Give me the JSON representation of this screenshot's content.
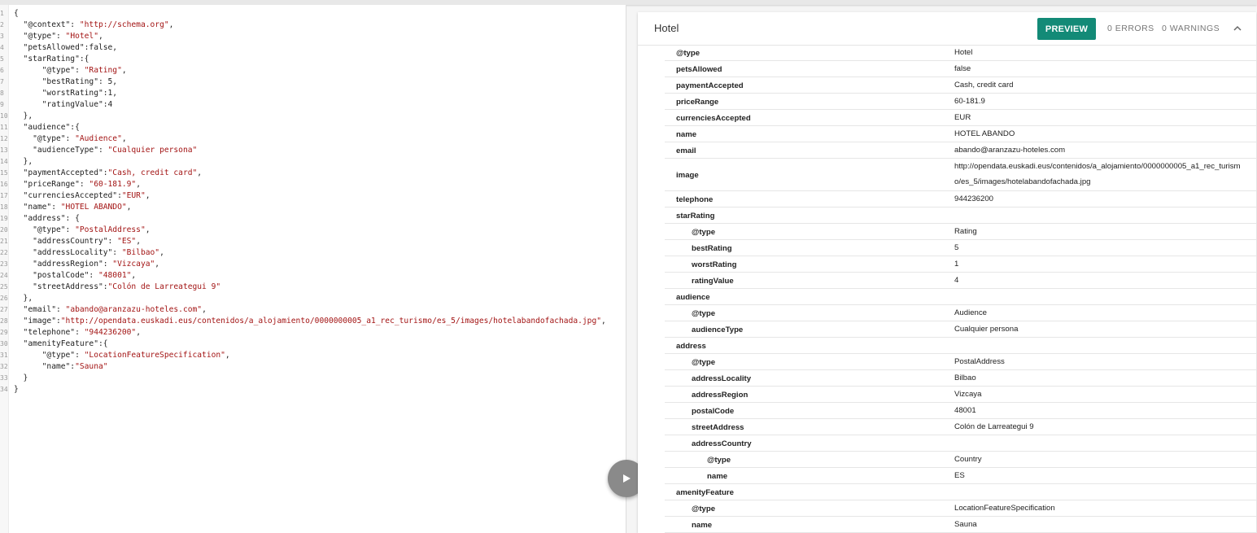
{
  "editor": {
    "lines": [
      "{",
      "  \"@context\": \"http://schema.org\",",
      "  \"@type\": \"Hotel\",",
      "  \"petsAllowed\":false,",
      "  \"starRating\":{",
      "      \"@type\": \"Rating\",",
      "      \"bestRating\": 5,",
      "      \"worstRating\":1,",
      "      \"ratingValue\":4",
      "  },",
      "  \"audience\":{",
      "    \"@type\": \"Audience\",",
      "    \"audienceType\": \"Cualquier persona\"",
      "  },",
      "  \"paymentAccepted\":\"Cash, credit card\",",
      "  \"priceRange\": \"60-181.9\",",
      "  \"currenciesAccepted\":\"EUR\",",
      "  \"name\": \"HOTEL ABANDO\",",
      "  \"address\": {",
      "    \"@type\": \"PostalAddress\",",
      "    \"addressCountry\": \"ES\",",
      "    \"addressLocality\": \"Bilbao\",",
      "    \"addressRegion\": \"Vizcaya\",",
      "    \"postalCode\": \"48001\",",
      "    \"streetAddress\":\"Colón de Larreategui 9\"",
      "  },",
      "  \"email\": \"abando@aranzazu-hoteles.com\",",
      "  \"image\":\"http://opendata.euskadi.eus/contenidos/a_alojamiento/0000000005_a1_rec_turismo/es_5/images/hotelabandofachada.jpg\",",
      "  \"telephone\": \"944236200\",",
      "  \"amenityFeature\":{",
      "      \"@type\": \"LocationFeatureSpecification\",",
      "      \"name\":\"Sauna\"",
      "  }",
      "}"
    ]
  },
  "panel": {
    "title": "Hotel",
    "preview_label": "PREVIEW",
    "errors_label": "0 ERRORS",
    "warnings_label": "0 WARNINGS",
    "rows": [
      {
        "prop": "@type",
        "value": "Hotel",
        "depth": 0
      },
      {
        "prop": "petsAllowed",
        "value": "false",
        "depth": 0
      },
      {
        "prop": "paymentAccepted",
        "value": "Cash, credit card",
        "depth": 0
      },
      {
        "prop": "priceRange",
        "value": "60-181.9",
        "depth": 0
      },
      {
        "prop": "currenciesAccepted",
        "value": "EUR",
        "depth": 0
      },
      {
        "prop": "name",
        "value": "HOTEL ABANDO",
        "depth": 0
      },
      {
        "prop": "email",
        "value": "abando@aranzazu-hoteles.com",
        "depth": 0
      },
      {
        "prop": "image",
        "value": "http://opendata.euskadi.eus/contenidos/a_alojamiento/0000000005_a1_rec_turismo/es_5/images/hotelabandofachada.jpg",
        "depth": 0,
        "tall": true
      },
      {
        "prop": "telephone",
        "value": "944236200",
        "depth": 0
      },
      {
        "prop": "starRating",
        "value": "",
        "depth": 0
      },
      {
        "prop": "@type",
        "value": "Rating",
        "depth": 1
      },
      {
        "prop": "bestRating",
        "value": "5",
        "depth": 1
      },
      {
        "prop": "worstRating",
        "value": "1",
        "depth": 1
      },
      {
        "prop": "ratingValue",
        "value": "4",
        "depth": 1
      },
      {
        "prop": "audience",
        "value": "",
        "depth": 0
      },
      {
        "prop": "@type",
        "value": "Audience",
        "depth": 1
      },
      {
        "prop": "audienceType",
        "value": "Cualquier persona",
        "depth": 1
      },
      {
        "prop": "address",
        "value": "",
        "depth": 0
      },
      {
        "prop": "@type",
        "value": "PostalAddress",
        "depth": 1
      },
      {
        "prop": "addressLocality",
        "value": "Bilbao",
        "depth": 1
      },
      {
        "prop": "addressRegion",
        "value": "Vizcaya",
        "depth": 1
      },
      {
        "prop": "postalCode",
        "value": "48001",
        "depth": 1
      },
      {
        "prop": "streetAddress",
        "value": "Colón de Larreategui 9",
        "depth": 1
      },
      {
        "prop": "addressCountry",
        "value": "",
        "depth": 1
      },
      {
        "prop": "@type",
        "value": "Country",
        "depth": 2
      },
      {
        "prop": "name",
        "value": "ES",
        "depth": 2
      },
      {
        "prop": "amenityFeature",
        "value": "",
        "depth": 0
      },
      {
        "prop": "@type",
        "value": "LocationFeatureSpecification",
        "depth": 1
      },
      {
        "prop": "name",
        "value": "Sauna",
        "depth": 1
      }
    ]
  },
  "icons": {
    "run": "play-icon",
    "collapse": "chevron-up-icon"
  },
  "colors": {
    "accent": "#138a77",
    "string": "#a31515",
    "run_button": "#8a8a8a"
  }
}
